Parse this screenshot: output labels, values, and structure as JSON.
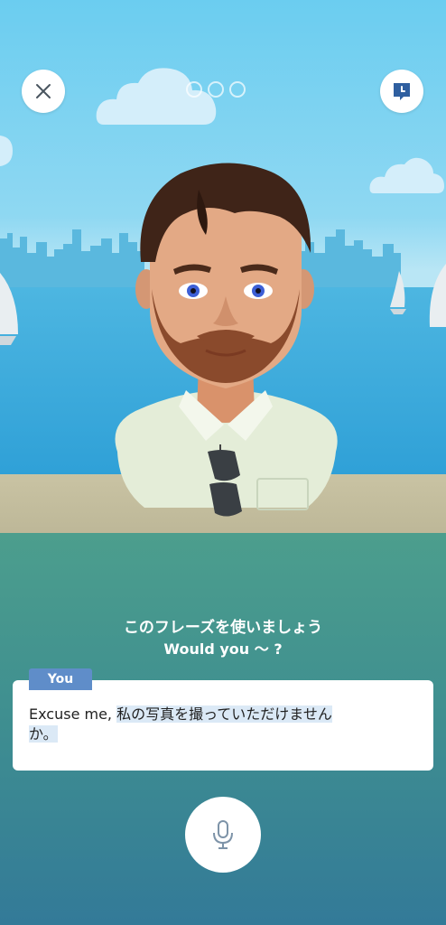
{
  "header": {
    "close_icon": "close-icon",
    "hint_icon": "chat-clock-icon",
    "progress_dots": 3
  },
  "prompt": {
    "japanese": "このフレーズを使いましょう",
    "english": "Would you 〜 ?"
  },
  "response_card": {
    "tag_label": "You",
    "prefix": "Excuse me, ",
    "highlighted": "私の写真を撮っていただけませんか。"
  },
  "mic_button": {
    "icon": "microphone-icon"
  },
  "colors": {
    "accent": "#5f8dc9",
    "highlight": "#dbe9f6"
  }
}
